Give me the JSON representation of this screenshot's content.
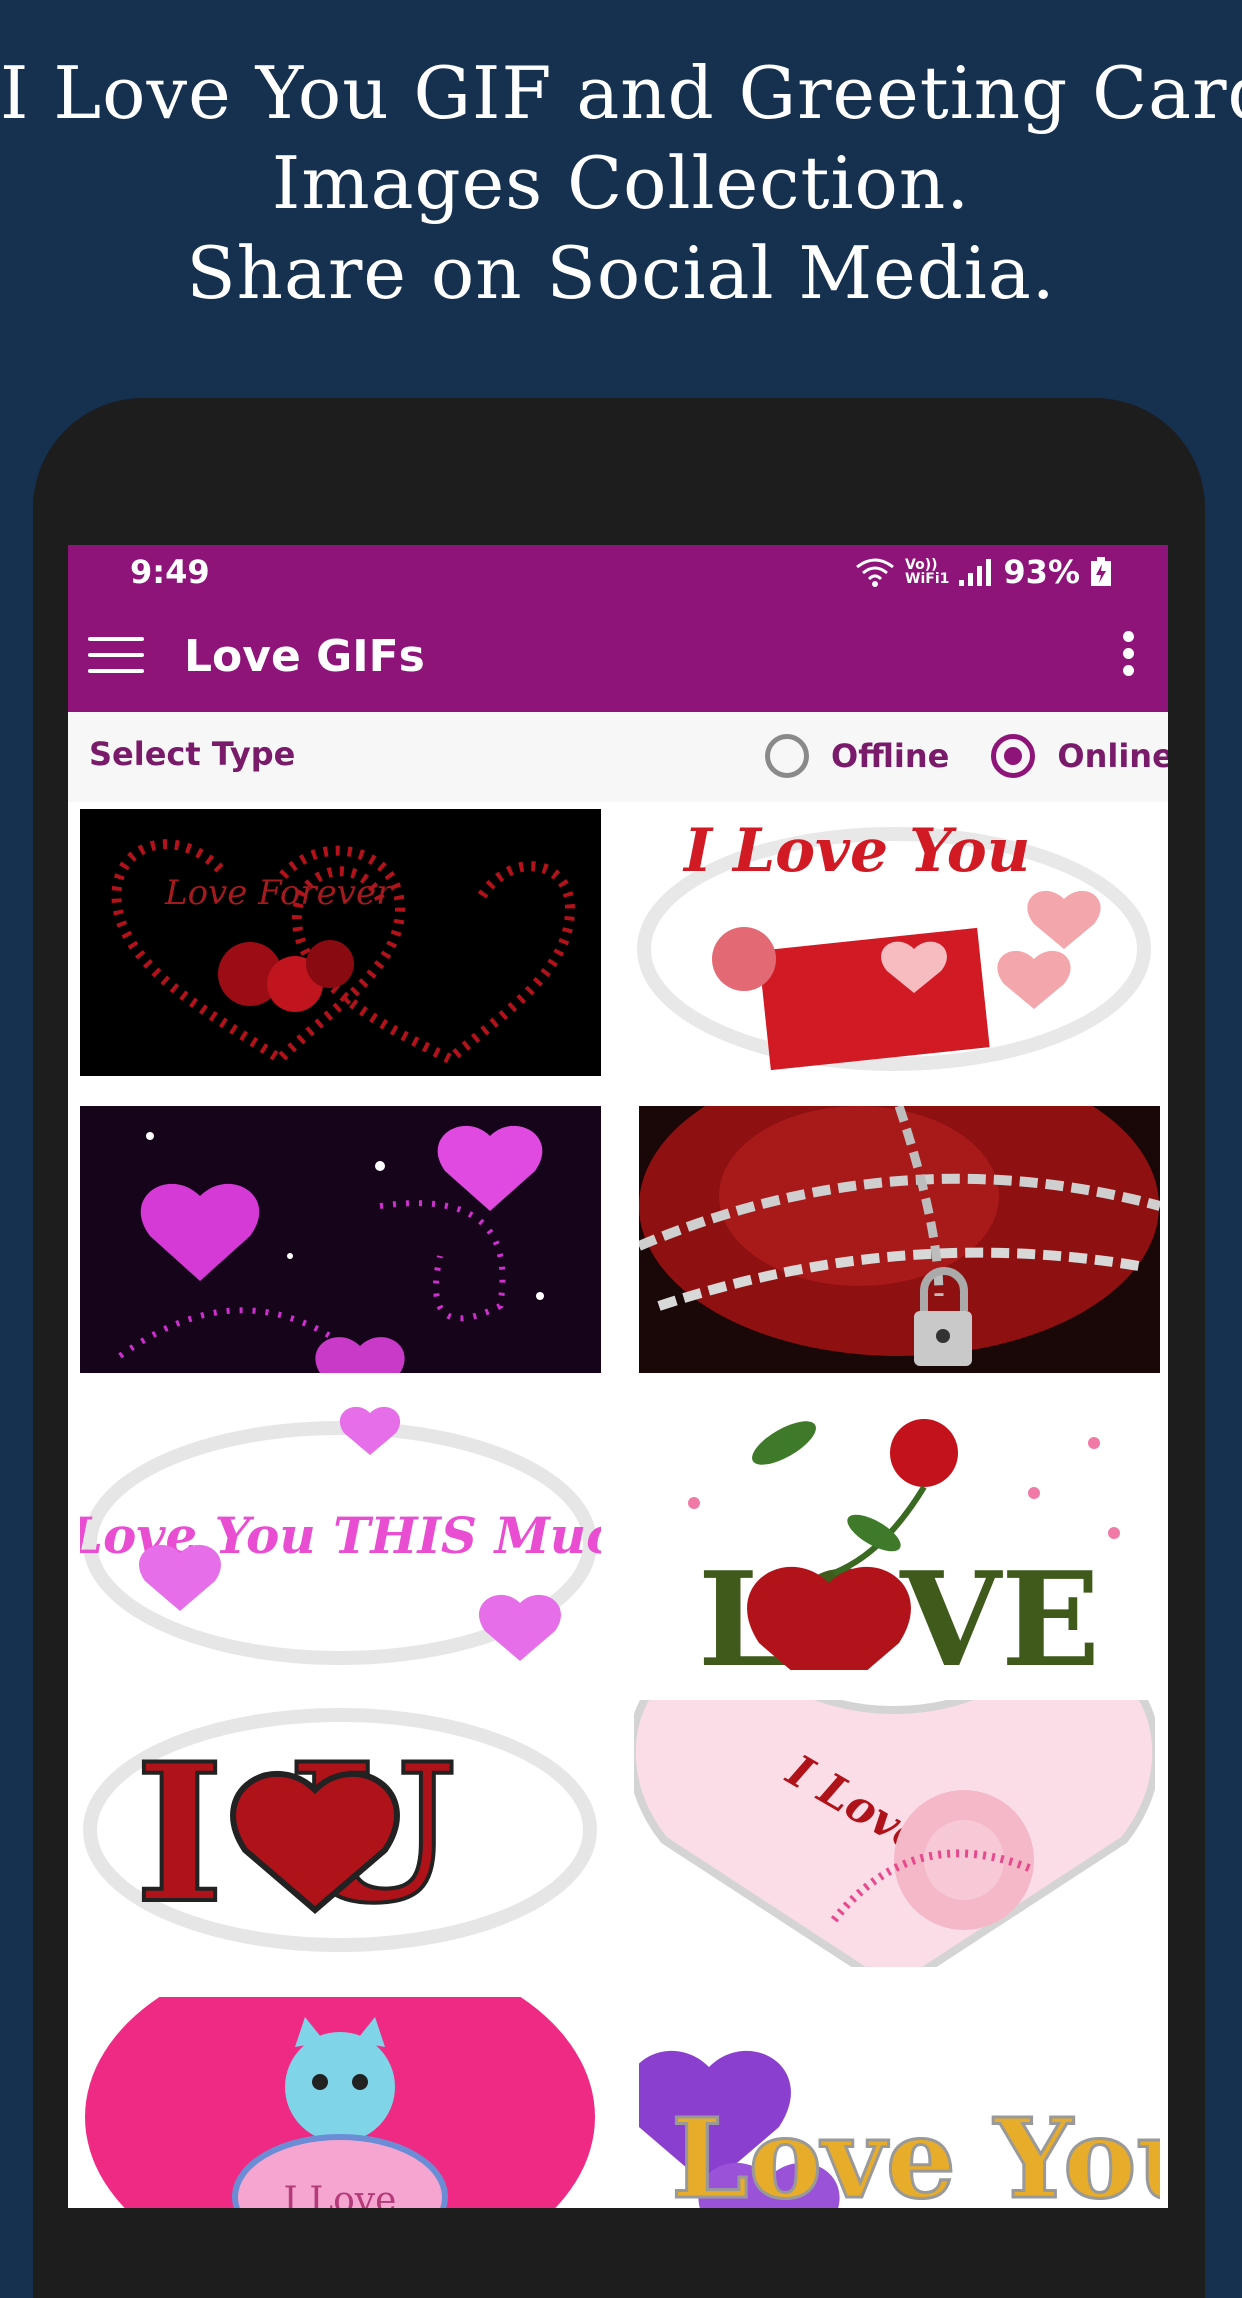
{
  "promo": {
    "line1": "I Love You GIF and Greeting Card",
    "line2": "Images Collection.",
    "line3": "Share on Social Media."
  },
  "status": {
    "time": "9:49",
    "volte_label": "Vo))",
    "wifi_label": "WiFi1",
    "battery": "93%"
  },
  "appbar": {
    "title": "Love GIFs"
  },
  "select_type": {
    "label": "Select Type",
    "options": [
      "Offline",
      "Online"
    ],
    "selected": "Online"
  },
  "tiles": [
    {
      "text": "Love Forever"
    },
    {
      "text": "I Love You"
    },
    {
      "text": ""
    },
    {
      "text": ""
    },
    {
      "text": "I Love You THIS Much"
    },
    {
      "text": "LOVE"
    },
    {
      "text": "I U"
    },
    {
      "text": "I Love You"
    },
    {
      "text": "I Love"
    },
    {
      "text": "I Love You"
    }
  ],
  "colors": {
    "background": "#16304f",
    "accent": "#8e1479",
    "phone": "#1d1d1d"
  }
}
